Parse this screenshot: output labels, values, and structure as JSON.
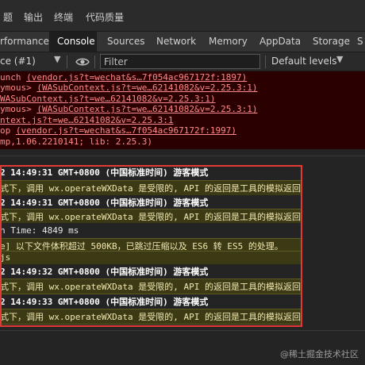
{
  "menu": [
    "题",
    "输出",
    "终端",
    "代码质量"
  ],
  "tabs": [
    "rformance",
    "Console",
    "Sources",
    "Network",
    "Memory",
    "AppData",
    "Storage",
    "S"
  ],
  "active_tab": "Console",
  "toolbar": {
    "context": "ce (#1)",
    "filter_placeholder": "Filter",
    "levels": "Default levels",
    "caret": "▼"
  },
  "error_lines": [
    {
      "prefix": "unch ",
      "link": "(vendor.js?t=wechat&s…7f054ac967172f:1897)",
      "suffix": ""
    },
    {
      "prefix": "ymous> ",
      "link": "(WASubContext.js?t=we…62141082&v=2.25.3:1)",
      "suffix": ""
    },
    {
      "prefix": "",
      "link": "WASubContext.js?t=we…62141082&v=2.25.3:1)",
      "suffix": ""
    },
    {
      "prefix": "ymous> ",
      "link": "(WASubContext.js?t=we…62141082&v=2.25.3:1)",
      "suffix": ""
    },
    {
      "prefix": "",
      "link": "ntext.js?t=we…62141082&v=2.25.3:1",
      "suffix": ""
    },
    {
      "prefix": "op ",
      "link": "(vendor.js?t=wechat&s…7f054ac967172f:1997)",
      "suffix": ""
    },
    {
      "prefix": "",
      "link": "",
      "suffix": "mp,1.06.2210141; lib: 2.25.3)"
    }
  ],
  "log_rows": [
    {
      "kind": "info",
      "text": "2 14:49:31 GMT+0800 (中国标准时间) 游客模式"
    },
    {
      "kind": "warn",
      "text": "式下，调用 wx.operateWXData 是受限的, API 的返回是工具的模拟返回"
    },
    {
      "kind": "info",
      "text": "2 14:49:31 GMT+0800 (中国标准时间) 游客模式"
    },
    {
      "kind": "warn",
      "text": "式下，调用 wx.operateWXData 是受限的, API 的返回是工具的模拟返回"
    },
    {
      "kind": "plain",
      "text": "n Time: 4849 ms"
    },
    {
      "kind": "warn",
      "text": "e] 以下文件体积超过 500KB，已跳过压缩以及 ES6 转 ES5 的处理。"
    },
    {
      "kind": "warn",
      "text": "js"
    },
    {
      "kind": "info",
      "text": "2 14:49:32 GMT+0800 (中国标准时间) 游客模式"
    },
    {
      "kind": "warn",
      "text": "式下，调用 wx.operateWXData 是受限的, API 的返回是工具的模拟返回"
    },
    {
      "kind": "info",
      "text": "2 14:49:33 GMT+0800 (中国标准时间) 游客模式"
    },
    {
      "kind": "warn",
      "text": "式下，调用 wx.operateWXData 是受限的, API 的返回是工具的模拟返回"
    }
  ],
  "watermark": "@稀土掘金技术社区",
  "colors": {
    "highlight_border": "#e53935",
    "error_bg": "#2b0000",
    "warn_bg": "#3b3a14"
  }
}
